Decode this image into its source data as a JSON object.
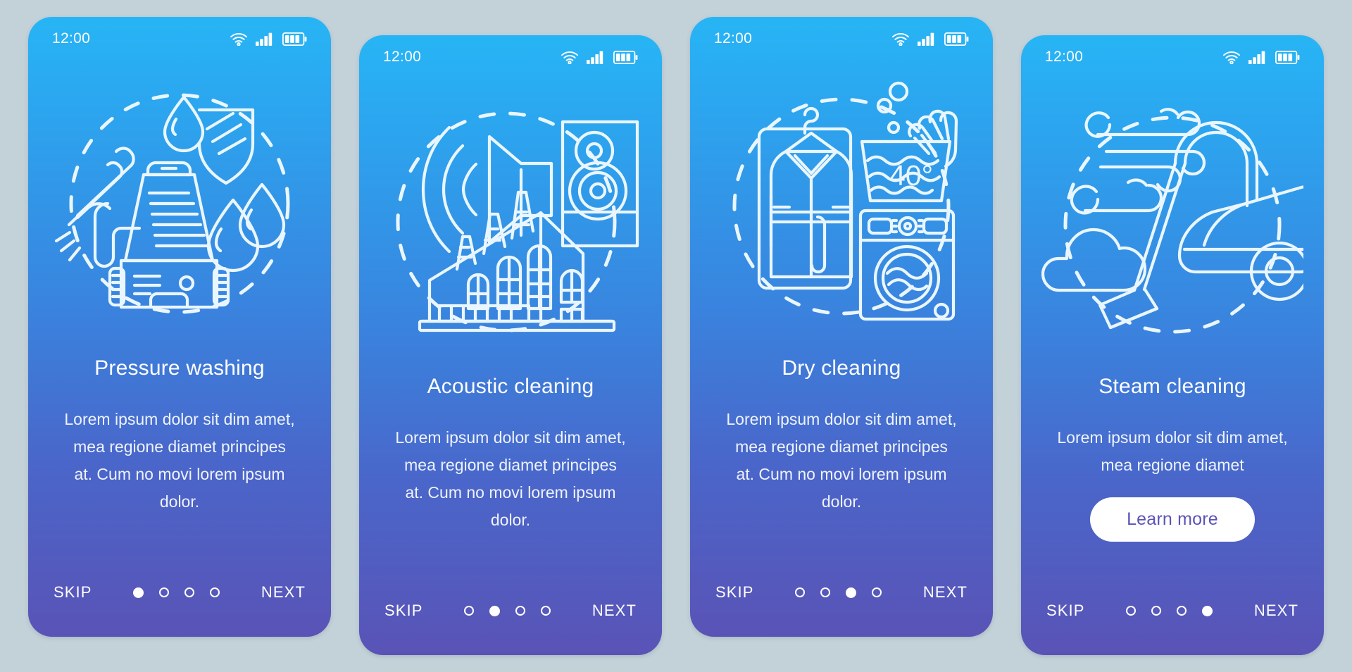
{
  "page": {
    "background_color": "#c3d1d9",
    "gradient_top": "#27b5f5",
    "gradient_bottom": "#5a53b6"
  },
  "status_bar": {
    "time": "12:00",
    "icons": [
      "wifi-icon",
      "cellular-signal-icon",
      "battery-icon"
    ]
  },
  "screens": [
    {
      "id": "pressure-washing",
      "title": "Pressure washing",
      "body": "Lorem ipsum dolor sit dim amet, mea regione diamet principes at. Cum no movi lorem ipsum dolor.",
      "illustration_name": "pressure-washer-illustration",
      "illustration_parts": [
        "spray-wand",
        "pressure-washer-machine",
        "water-drop-shield",
        "water-droplets",
        "dashed-circle"
      ],
      "skip_label": "SKIP",
      "next_label": "NEXT",
      "dots": 4,
      "active_dot": 1,
      "cta": null
    },
    {
      "id": "acoustic-cleaning",
      "title": "Acoustic cleaning",
      "body": "Lorem ipsum dolor sit dim amet, mea regione diamet principes at. Cum no movi lorem ipsum dolor.",
      "illustration_name": "acoustic-cleaning-illustration",
      "illustration_parts": [
        "megaphone-sound-waves",
        "loudspeaker-cabinet",
        "factory-building",
        "dashed-circle"
      ],
      "skip_label": "SKIP",
      "next_label": "NEXT",
      "dots": 4,
      "active_dot": 2,
      "cta": null
    },
    {
      "id": "dry-cleaning",
      "title": "Dry cleaning",
      "body": "Lorem ipsum dolor sit dim amet, mea regione diamet principes at. Cum no movi lorem ipsum dolor.",
      "illustration_name": "dry-cleaning-illustration",
      "illustration_parts": [
        "garment-bag-coat-hanger",
        "hand-wash-basin",
        "washing-machine",
        "dashed-circle"
      ],
      "illustration_label": "40°",
      "skip_label": "SKIP",
      "next_label": "NEXT",
      "dots": 4,
      "active_dot": 3,
      "cta": null
    },
    {
      "id": "steam-cleaning",
      "title": "Steam cleaning",
      "body": "Lorem ipsum dolor sit dim amet, mea regione diamet",
      "illustration_name": "steam-cleaning-illustration",
      "illustration_parts": [
        "steam-swirls",
        "cloud",
        "vacuum-cleaner",
        "dashed-circle"
      ],
      "skip_label": "SKIP",
      "next_label": "NEXT",
      "dots": 4,
      "active_dot": 4,
      "cta": "Learn more"
    }
  ]
}
